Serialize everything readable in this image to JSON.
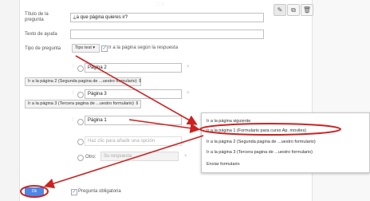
{
  "toolbar": {
    "drag_handle": "::::",
    "edit_icon": "pencil-icon",
    "copy_icon": "copy-icon",
    "delete_icon": "trash-icon"
  },
  "form": {
    "title_label": "Título de la pregunta",
    "title_value": "¿a que página quieres ir?",
    "help_label": "Texto de ayuda",
    "help_value": "",
    "type_label": "Tipo de pregunta",
    "type_value": "Tipo test",
    "goto_label": "Ir a la página según la respuesta",
    "options": [
      {
        "value": "Página 2",
        "goto": "Ir a la página 2 (Segunda pagina de ...uestro formulario)"
      },
      {
        "value": "Página 3",
        "goto": "Ir a la página 3 (Tercera pagina de ...uestro formulario)"
      },
      {
        "value": "Página 1"
      }
    ],
    "add_option_placeholder": "Haz clic para añadir una opción",
    "other_label": "Otro:",
    "other_placeholder": "Su respuesta",
    "required_label": "Pregunta obligatoria",
    "ok_label": "Ok"
  },
  "dropdown": {
    "items": [
      "Ir a la página siguiente",
      "Ir a la página 1 (Formulario para curso Ap. moviles)",
      "Ir a la página 2 (Segunda pagina de ...uestro formulario)",
      "Ir a la página 3 (Tercera pagina de ...uestro formulario)",
      "Enviar formulario"
    ],
    "highlighted_index": 1
  },
  "annotation_color": "#cc2222",
  "accent_color": "#4d86e4"
}
